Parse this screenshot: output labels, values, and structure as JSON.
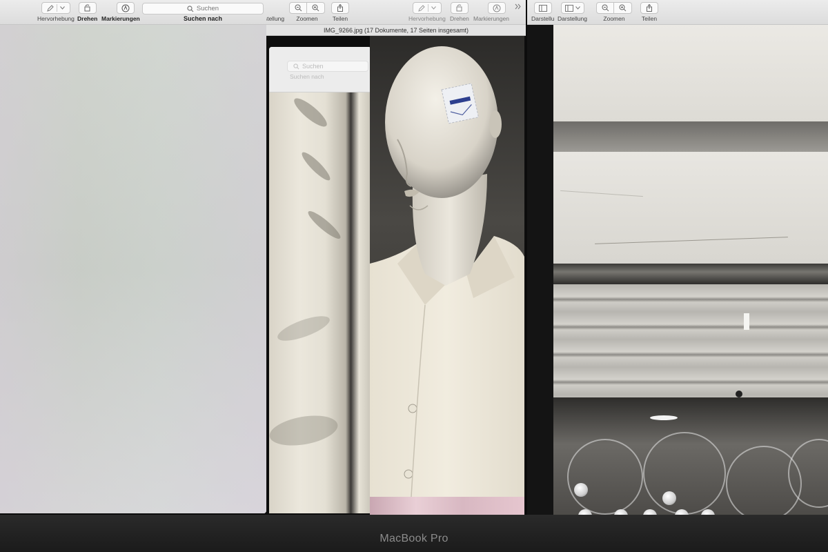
{
  "left_window": {
    "toolbar": {
      "highlight_label": "Hervorhebung",
      "rotate_label": "Drehen",
      "markup_label": "Markierungen",
      "search_placeholder": "Suchen",
      "search_label": "Suchen nach"
    }
  },
  "middle_window": {
    "toolbar": {
      "view_label_partial": "rstellung",
      "zoom_label": "Zoomen",
      "share_label": "Teilen",
      "highlight_label": "Hervorhebung",
      "rotate_label": "Drehen",
      "markup_label": "Markierungen",
      "overflow_icon": "chevron-double-right"
    },
    "title": "IMG_9266.jpg (17 Dokumente, 17 Seiten insgesamt)",
    "inner_window": {
      "search_placeholder": "Suchen",
      "search_label": "Suchen nach"
    }
  },
  "right_window": {
    "toolbar": {
      "view_label_partial": "Darstellu",
      "view_label": "Darstellung",
      "zoom_label": "Zoomen",
      "share_label": "Teilen"
    }
  },
  "bezel": {
    "brand": "MacBook Pro"
  }
}
